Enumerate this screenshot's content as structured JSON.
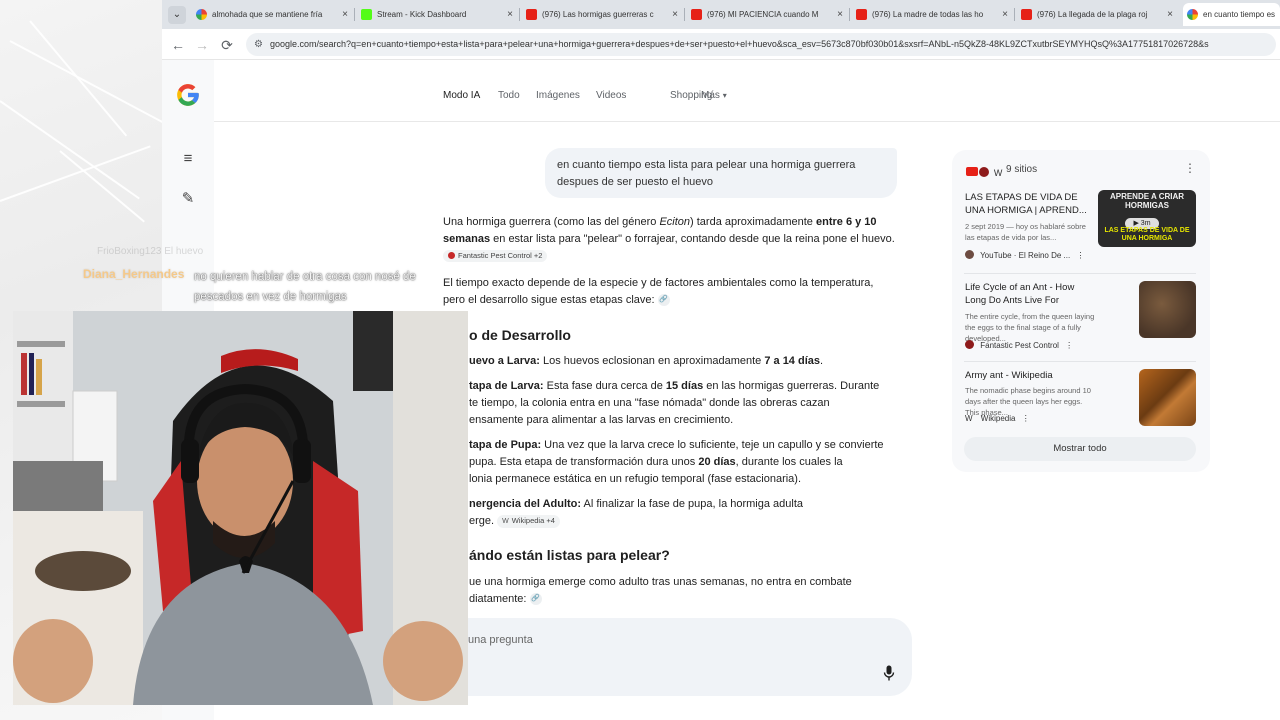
{
  "browser": {
    "tabs": [
      {
        "title": "almohada que se mantiene fría",
        "favicon": "google-icon"
      },
      {
        "title": "Stream - Kick Dashboard",
        "favicon": "kick-icon"
      },
      {
        "title": "(976) Las hormigas guerreras c",
        "favicon": "youtube-icon"
      },
      {
        "title": "(976) MI PACIENCIA cuando M",
        "favicon": "youtube-icon"
      },
      {
        "title": "(976) La madre de todas las ho",
        "favicon": "youtube-icon"
      },
      {
        "title": "(976) La llegada de la plaga roj",
        "favicon": "youtube-icon"
      },
      {
        "title": "en cuanto tiempo es",
        "favicon": "google-icon"
      }
    ],
    "tab_close": "×",
    "tab_dropdown": "⌄",
    "url": "google.com/search?q=en+cuanto+tiempo+esta+lista+para+pelear+una+hormiga+guerrera+despues+de+ser+puesto+el+huevo&sca_esv=5673c870bf030b01&sxsrf=ANbL-n5QkZ8-48KL9ZCTxutbrSEYMYHQsQ%3A17751817026728&s"
  },
  "search_nav": {
    "items": [
      "Modo IA",
      "Todo",
      "Imágenes",
      "Videos",
      "Shopping",
      "Más"
    ],
    "more_caret": "▾"
  },
  "query": "en cuanto tiempo esta lista para pelear una hormiga guerrera despues de ser puesto el huevo",
  "answer": {
    "intro_1": "Una hormiga guerrera (como las del género ",
    "intro_genus": "Eciton",
    "intro_2": ") tarda aproximadamente ",
    "intro_bold": "entre 6 y 10 semanas",
    "intro_3": " en estar lista para \"pelear\" o forrajear, contando desde que la reina pone el huevo.",
    "intro_chip": "Fantastic Pest Control +2",
    "p2": "El tiempo exacto depende de la especie y de factores ambientales como la temperatura, pero el desarrollo sigue estas etapas clave:",
    "heading1": "o de Desarrollo",
    "s1_label": "uevo a Larva:",
    "s1_text": " Los huevos eclosionan en aproximadamente ",
    "s1_bold": "7 a 14 días",
    "s1_end": ".",
    "s2_label": "tapa de Larva:",
    "s2_text1": " Esta fase dura cerca de ",
    "s2_bold": "15 días",
    "s2_text2": " en las hormigas guerreras. Durante",
    "s2_line2": "te tiempo, la colonia entra en una \"fase nómada\" donde las obreras cazan",
    "s2_line3": "ensamente para alimentar a las larvas en crecimiento.",
    "s3_label": "tapa de Pupa:",
    "s3_text1": " Una vez que la larva crece lo suficiente, teje un capullo y se convierte",
    "s3_line2a": " pupa. Esta etapa de transformación dura unos ",
    "s3_bold": "20 días",
    "s3_line2b": ", durante los cuales la",
    "s3_line3": "lonia permanece estática en un refugio temporal (fase estacionaria).",
    "s4_label": "nergencia del Adulto:",
    "s4_text1": " Al finalizar la fase de pupa, la hormiga adulta",
    "s4_line2": "erge.",
    "s4_chip": "Wikipedia +4",
    "heading2": "ándo están listas para pelear?",
    "p_last1": "ue una hormiga emerge como adulto tras unas semanas, no entra en combate",
    "p_last2": "diatamente:"
  },
  "ask_placeholder": "una pregunta",
  "sources": {
    "count": "9 sitios",
    "more": "⋮",
    "items": [
      {
        "title": "LAS ETAPAS DE VIDA DE UNA HORMIGA | APREND...",
        "desc": "2 sept 2019 — hoy os hablaré sobre las etapas de vida por las...",
        "site": "YouTube · El Reino De ...",
        "thumb_top": "APRENDE A CRIAR HORMIGAS",
        "thumb_duration": "3m",
        "thumb_bottom": "LAS ETAPAS DE VIDA DE UNA HORMIGA"
      },
      {
        "title": "Life Cycle of an Ant - How Long Do Ants Live For",
        "desc": "The entire cycle, from the queen laying the eggs to the final stage of a fully developed...",
        "site": "Fantastic Pest Control"
      },
      {
        "title": "Army ant - Wikipedia",
        "desc": "The nomadic phase begins around 10 days after the queen lays her eggs. This phase...",
        "site": "Wikipedia"
      }
    ],
    "show_all": "Mostrar todo"
  },
  "chat": {
    "faded_line": "FrioBoxing123  El huevo",
    "username": "Diana_Hernandes",
    "message": "no quieren hablar de otra cosa con nosé de pescados en vez de hormigas"
  },
  "colors": {
    "chat_username": "#f5c98a",
    "youtube_red": "#e62117",
    "google_blue": "#4285f4"
  }
}
